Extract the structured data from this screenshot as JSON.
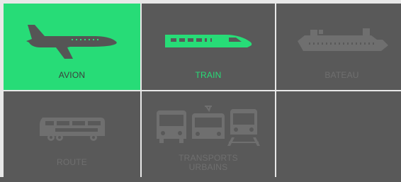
{
  "tiles": [
    {
      "key": "avion",
      "label": "AVION",
      "state": "active",
      "icon": "airplane-icon"
    },
    {
      "key": "train",
      "label": "TRAIN",
      "state": "hover",
      "icon": "train-icon"
    },
    {
      "key": "bateau",
      "label": "BATEAU",
      "state": "normal",
      "icon": "ship-icon"
    },
    {
      "key": "route",
      "label": "ROUTE",
      "state": "normal",
      "icon": "bus-icon"
    },
    {
      "key": "transports_urbains",
      "label": "TRANSPORTS\nURBAINS",
      "state": "normal",
      "icon": "urban-transport-icon"
    }
  ],
  "colors": {
    "active": "#27dc77",
    "tile": "#595959",
    "icon_dim": "#6f6f6f",
    "icon_active": "#555555",
    "border": "#e8e8e8"
  }
}
